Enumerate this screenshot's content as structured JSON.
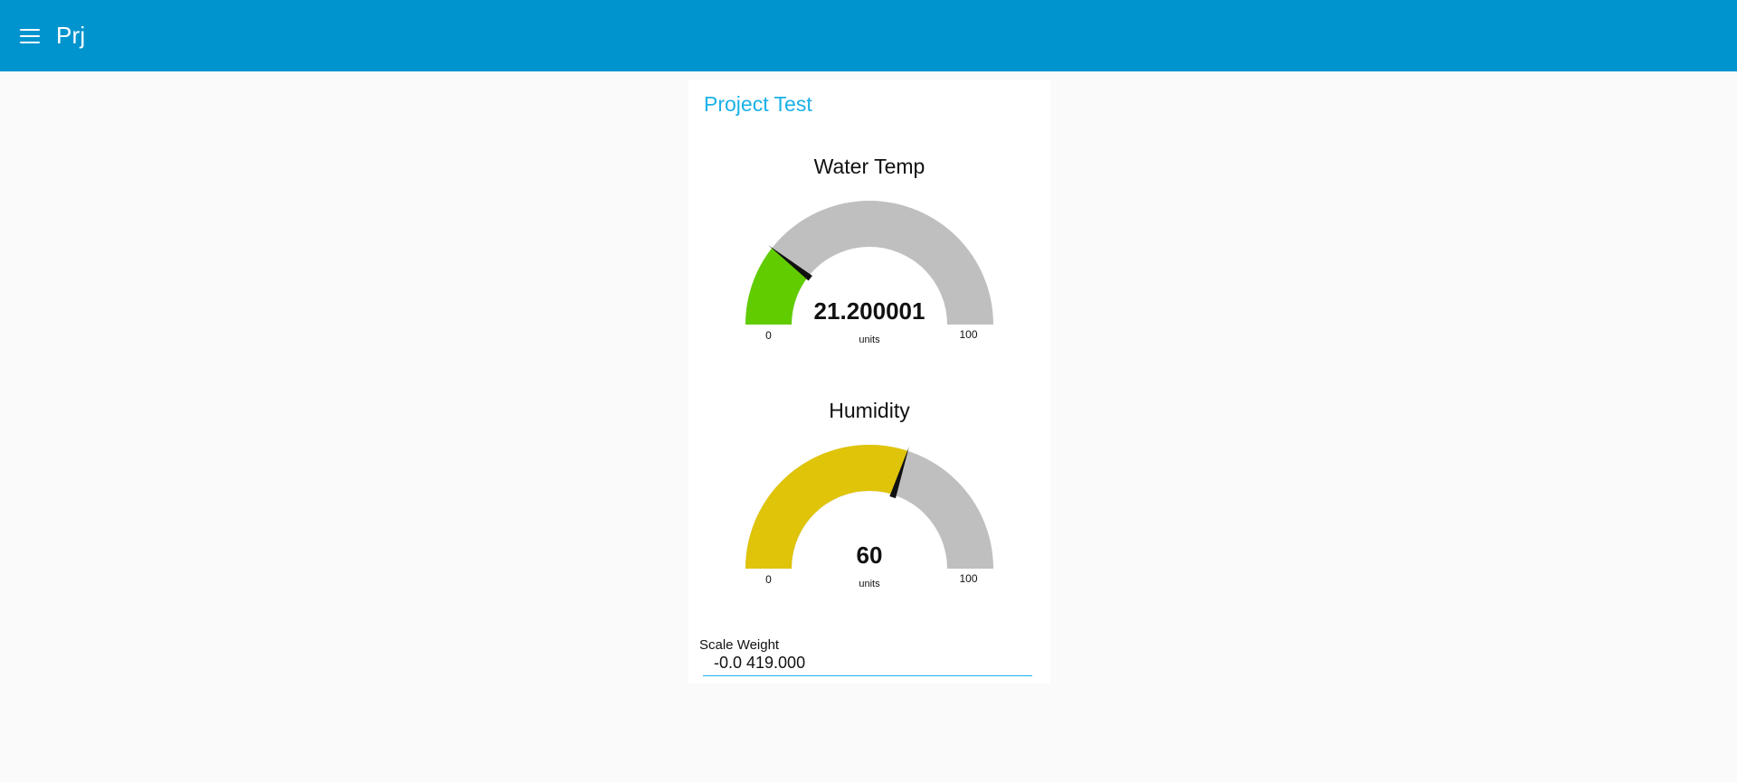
{
  "toolbar": {
    "title": "Prj",
    "background": "#0094ce",
    "menu_icon": "hamburger-menu-icon"
  },
  "group": {
    "title": "Project Test"
  },
  "gauges": [
    {
      "title": "Water Temp",
      "value": 21.200001,
      "value_text": "21.200001",
      "units": "units",
      "min": 0,
      "max": 100,
      "min_label": "0",
      "max_label": "100",
      "color": "#61cc00",
      "track_color": "#bfbfbf"
    },
    {
      "title": "Humidity",
      "value": 60,
      "value_text": "60",
      "units": "units",
      "min": 0,
      "max": 100,
      "min_label": "0",
      "max_label": "100",
      "color": "#dfc40a",
      "track_color": "#bfbfbf"
    }
  ],
  "scale": {
    "label": "Scale Weight",
    "value": "-0.0 419.000"
  }
}
